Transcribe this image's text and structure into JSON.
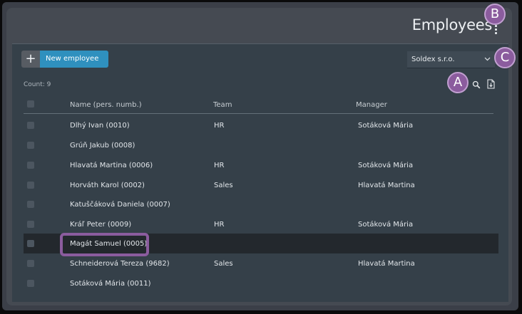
{
  "page": {
    "title": "Employees"
  },
  "toolbar": {
    "new_button_label": "New employee",
    "plus_glyph": "+",
    "company_select_value": "Soldex s.r.o."
  },
  "list": {
    "count_text": "Count: 9",
    "columns": {
      "name": "Name (pers. numb.)",
      "team": "Team",
      "manager": "Manager"
    },
    "rows": [
      {
        "name": "Dlhý Ivan (0010)",
        "team": "HR",
        "manager": "Sotáková Mária"
      },
      {
        "name": "Grúň Jakub (0008)",
        "team": "",
        "manager": ""
      },
      {
        "name": "Hlavatá Martina (0006)",
        "team": "HR",
        "manager": "Sotáková Mária"
      },
      {
        "name": "Horváth Karol (0002)",
        "team": "Sales",
        "manager": "Hlavatá Martina"
      },
      {
        "name": "Katuščáková Daniela (0007)",
        "team": "",
        "manager": ""
      },
      {
        "name": "Kráľ Peter (0009)",
        "team": "HR",
        "manager": "Sotáková Mária"
      },
      {
        "name": "Magát Samuel (0005)",
        "team": "",
        "manager": ""
      },
      {
        "name": "Schneiderová Tereza (9682)",
        "team": "Sales",
        "manager": "Hlavatá Martina"
      },
      {
        "name": "Sotáková Mária (0011)",
        "team": "",
        "manager": ""
      }
    ]
  },
  "annotations": {
    "a": "A",
    "b": "B",
    "c": "C"
  },
  "colors": {
    "accent": "#2f90be",
    "annotation": "#8b5c9e",
    "selected_row": "#23282d"
  },
  "icons": [
    "kebab-menu-icon",
    "plus-icon",
    "chevron-down-icon",
    "search-icon",
    "export-file-icon"
  ]
}
